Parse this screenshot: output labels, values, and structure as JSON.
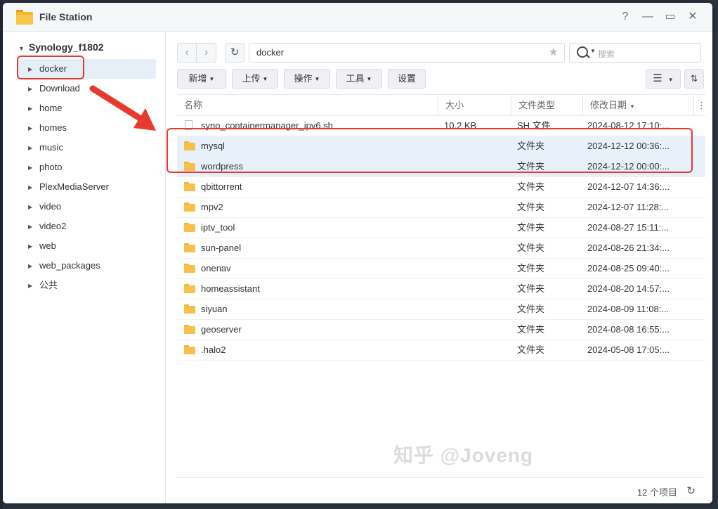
{
  "window": {
    "title": "File Station",
    "controls": {
      "help": "?",
      "minimize": "—",
      "maximize": "▭",
      "close": "✕"
    }
  },
  "sidebar": {
    "root": "Synology_f1802",
    "items": [
      {
        "label": "docker",
        "active": true
      },
      {
        "label": "Download"
      },
      {
        "label": "home"
      },
      {
        "label": "homes"
      },
      {
        "label": "music"
      },
      {
        "label": "photo"
      },
      {
        "label": "PlexMediaServer"
      },
      {
        "label": "video"
      },
      {
        "label": "video2"
      },
      {
        "label": "web"
      },
      {
        "label": "web_packages"
      },
      {
        "label": "公共"
      }
    ]
  },
  "nav": {
    "path": "docker",
    "search_placeholder": "搜索"
  },
  "toolbar": {
    "new_label": "新增",
    "upload_label": "上传",
    "action_label": "操作",
    "tools_label": "工具",
    "settings_label": "设置"
  },
  "table": {
    "columns": [
      "名称",
      "大小",
      "文件类型",
      "修改日期"
    ],
    "rows": [
      {
        "name": "syno_containermanager_ipv6.sh",
        "size": "10.2 KB",
        "type": "SH 文件",
        "date": "2024-08-12 17:10:...",
        "kind": "file"
      },
      {
        "name": "mysql",
        "size": "",
        "type": "文件夹",
        "date": "2024-12-12 00:36:...",
        "kind": "folder",
        "selected": true
      },
      {
        "name": "wordpress",
        "size": "",
        "type": "文件夹",
        "date": "2024-12-12 00:00:...",
        "kind": "folder",
        "selected": true
      },
      {
        "name": "qbittorrent",
        "size": "",
        "type": "文件夹",
        "date": "2024-12-07 14:36:...",
        "kind": "folder"
      },
      {
        "name": "mpv2",
        "size": "",
        "type": "文件夹",
        "date": "2024-12-07 11:28:...",
        "kind": "folder"
      },
      {
        "name": "iptv_tool",
        "size": "",
        "type": "文件夹",
        "date": "2024-08-27 15:11:...",
        "kind": "folder"
      },
      {
        "name": "sun-panel",
        "size": "",
        "type": "文件夹",
        "date": "2024-08-26 21:34:...",
        "kind": "folder"
      },
      {
        "name": "onenav",
        "size": "",
        "type": "文件夹",
        "date": "2024-08-25 09:40:...",
        "kind": "folder"
      },
      {
        "name": "homeassistant",
        "size": "",
        "type": "文件夹",
        "date": "2024-08-20 14:57:...",
        "kind": "folder"
      },
      {
        "name": "siyuan",
        "size": "",
        "type": "文件夹",
        "date": "2024-08-09 11:08:...",
        "kind": "folder"
      },
      {
        "name": "geoserver",
        "size": "",
        "type": "文件夹",
        "date": "2024-08-08 16:55:...",
        "kind": "folder"
      },
      {
        "name": ".halo2",
        "size": "",
        "type": "文件夹",
        "date": "2024-05-08 17:05:...",
        "kind": "folder"
      }
    ]
  },
  "status": {
    "count": "12 个项目"
  },
  "watermark": "知乎 @Joveng",
  "colors": {
    "annotation": "#e8392f",
    "selected_row": "#e8f0fa",
    "folder": "#f7c04a"
  }
}
